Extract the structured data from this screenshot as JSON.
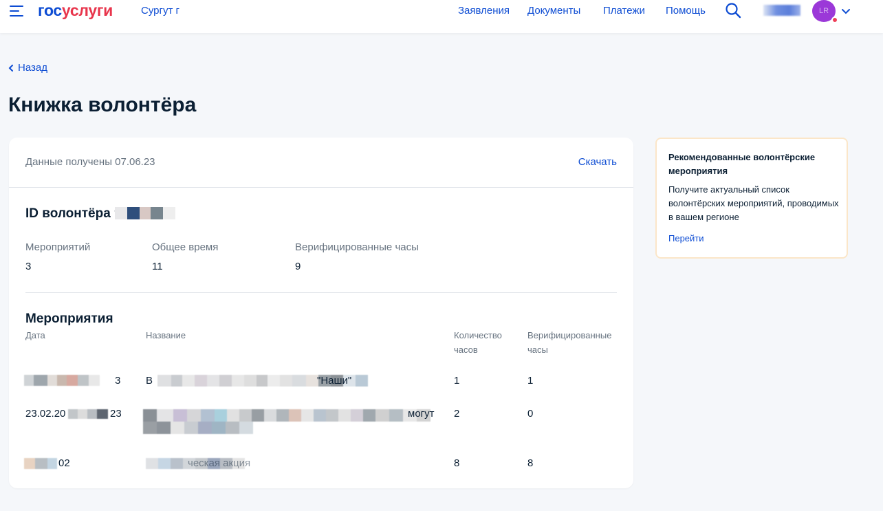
{
  "header": {
    "logo_part1": "гос",
    "logo_part2": "услуги",
    "city": "Сургут г",
    "nav": [
      "Заявления",
      "Документы",
      "Платежи",
      "Помощь"
    ],
    "avatar_initials": "LR",
    "colors": {
      "brand": "#0d4cd3",
      "accent": "#e8354c",
      "avatar": "#9b38d8"
    }
  },
  "back_label": "Назад",
  "page_title": "Книжка волонтёра",
  "card": {
    "received": "Данные получены 07.06.23",
    "download_label": "Скачать",
    "volunteer_id_label": "ID волонтёра 9",
    "stats": [
      {
        "label": "Мероприятий",
        "value": "3"
      },
      {
        "label": "Общее время",
        "value": "11"
      },
      {
        "label": "Верифицированные часы",
        "value": "9"
      }
    ],
    "events_title": "Мероприятия",
    "columns": {
      "date": "Дата",
      "name": "Название",
      "hours_line1": "Количество",
      "hours_line2": "часов",
      "verified_line1": "Верифицированные",
      "verified_line2": "часы"
    },
    "rows": [
      {
        "date": "3",
        "name": "В",
        "name_tail": "\"Наши\"",
        "hours": "1",
        "verified": "1"
      },
      {
        "date": "23.02.20",
        "date_tail": "23",
        "name": "могут",
        "hours": "2",
        "verified": "0"
      },
      {
        "date": "02",
        "name": "ческая акция",
        "hours": "8",
        "verified": "8"
      }
    ]
  },
  "side": {
    "title": "Рекомендованные волонтёрские мероприятия",
    "text": "Получите актуальный список волонтёрских мероприятий, проводимых в вашем регионе",
    "link": "Перейти"
  }
}
